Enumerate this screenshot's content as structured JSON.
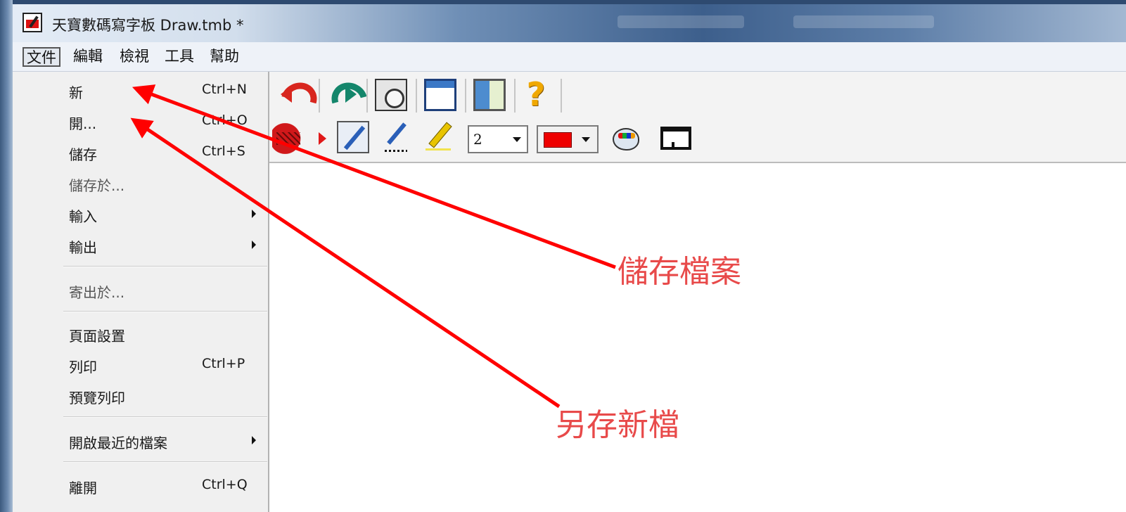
{
  "window": {
    "title": "天寶數碼寫字板 Draw.tmb *"
  },
  "menubar": {
    "items": [
      {
        "label": "文件",
        "active": true
      },
      {
        "label": "編輯",
        "active": false
      },
      {
        "label": "檢視",
        "active": false
      },
      {
        "label": "工具",
        "active": false
      },
      {
        "label": "幫助",
        "active": false
      }
    ]
  },
  "toolbar": {
    "row1": [
      "undo-icon",
      "redo-icon",
      "paste-icon",
      "window-icon",
      "pages-icon",
      "help-icon"
    ],
    "row2": [
      "fill-tool",
      "pen-tool",
      "dotted-pen-tool",
      "highlighter-tool",
      "size-combo",
      "color-combo",
      "palette-icon",
      "monitor-icon"
    ],
    "pen_size": "2",
    "pen_color": "#ee0000"
  },
  "file_menu": {
    "items": [
      {
        "label": "新",
        "shortcut": "Ctrl+N"
      },
      {
        "label": "開...",
        "shortcut": "Ctrl+O"
      },
      {
        "label": "儲存",
        "shortcut": "Ctrl+S"
      },
      {
        "label": "儲存於...",
        "shortcut": ""
      },
      {
        "label": "輸入",
        "shortcut": "",
        "submenu": true
      },
      {
        "label": "輸出",
        "shortcut": "",
        "submenu": true
      },
      {
        "label": "寄出於...",
        "shortcut": ""
      },
      {
        "label": "頁面設置",
        "shortcut": ""
      },
      {
        "label": "列印",
        "shortcut": "Ctrl+P"
      },
      {
        "label": "預覽列印",
        "shortcut": ""
      },
      {
        "label": "開啟最近的檔案",
        "shortcut": "",
        "submenu": true
      },
      {
        "label": "離開",
        "shortcut": "Ctrl+Q"
      }
    ]
  },
  "annotations": {
    "save_file": "儲存檔案",
    "save_as": "另存新檔",
    "arrow_color": "#ff0000"
  },
  "colors": {
    "annotation_text": "#e84a4a",
    "menu_background": "#f0f0f0",
    "toolbar_background": "#f3f3f3"
  }
}
